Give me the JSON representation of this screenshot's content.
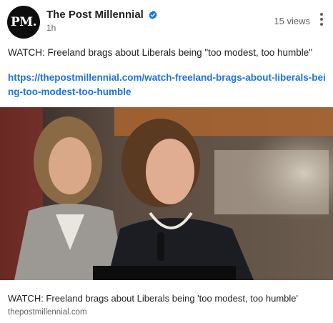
{
  "header": {
    "avatar_text": "PM.",
    "page_name": "The Post Millennial",
    "time": "1h",
    "views": "15 views"
  },
  "post": {
    "text": "WATCH: Freeland brags about Liberals being \"too modest, too humble\"",
    "link": "https://thepostmillennial.com/watch-freeland-brags-about-liberals-being-too-modest-too-humble"
  },
  "link_preview": {
    "title": "WATCH: Freeland brags about Liberals being 'too modest, too humble'",
    "domain": "thepostmillennial.com"
  },
  "colors": {
    "link": "#1a73e8",
    "verified": "#1a73e8",
    "avatar_bg": "#0d0d0d"
  },
  "icons": [
    "verified-badge-icon",
    "more-vert-icon"
  ]
}
